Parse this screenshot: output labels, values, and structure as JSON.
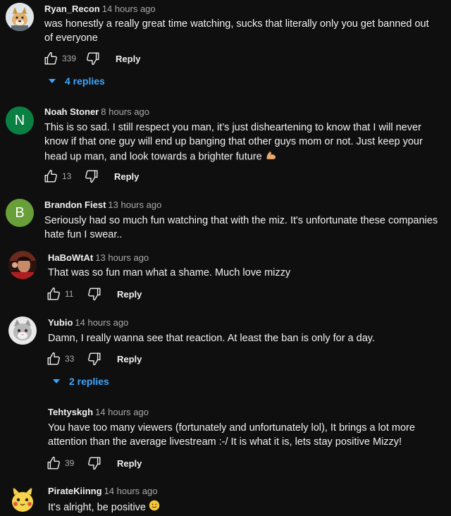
{
  "reply_label": "Reply",
  "comments": [
    {
      "author": "Ryan_Recon",
      "time": "14 hours ago",
      "text": "was honestly a really great time watching, sucks that literally only you get banned out of everyone",
      "likes": "339",
      "replies_label": "4 replies",
      "avatar": "dog-avatar"
    },
    {
      "author": "Noah Stoner",
      "time": "8 hours ago",
      "text": "This is so sad.  I still respect you man,  it’s just disheartening to know that I will never know if that one guy will end up banging that other guys mom or not.   Just keep your head up man, and look towards a brighter future",
      "emoji": "flexed-biceps",
      "likes": "13",
      "avatar_letter": "N",
      "avatar_color": "#0b8043"
    },
    {
      "author": "Brandon Fiest",
      "time": "13 hours ago",
      "text": "Seriously had so much fun watching that with the miz. It's unfortunate these companies hate fun I swear..",
      "avatar_letter": "B",
      "avatar_color": "#689f38"
    },
    {
      "author": "HaBoWtAt",
      "time": "13 hours ago",
      "text": "That was so fun man what a shame. Much love mizzy",
      "likes": "11",
      "avatar": "photo-avatar"
    },
    {
      "author": "Yubio",
      "time": "14 hours ago",
      "text": "Damn, I really wanna see that reaction. At least the ban is only for a day.",
      "likes": "33",
      "replies_label": "2 replies",
      "avatar": "cat-avatar"
    },
    {
      "author": "Tehtyskgh",
      "time": "14 hours ago",
      "text": "You have too many viewers (fortunately and unfortunately lol), It brings a lot more attention than the average livestream :-/ It is what it is, lets stay positive Mizzy!",
      "likes": "39"
    },
    {
      "author": "PirateKiinng",
      "time": "14 hours ago",
      "text": "It's alright, be positive",
      "emoji": "slightly-smiling-face",
      "avatar": "pikachu-avatar"
    }
  ]
}
